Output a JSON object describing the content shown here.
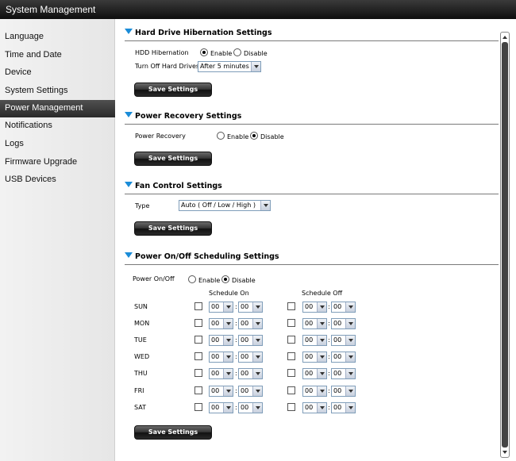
{
  "window": {
    "title": "System Management"
  },
  "sidebar": {
    "items": [
      {
        "label": "Language"
      },
      {
        "label": "Time and Date"
      },
      {
        "label": "Device"
      },
      {
        "label": "System Settings"
      },
      {
        "label": "Power Management",
        "active": true
      },
      {
        "label": "Notifications"
      },
      {
        "label": "Logs"
      },
      {
        "label": "Firmware Upgrade"
      },
      {
        "label": "USB Devices"
      }
    ]
  },
  "hibernation": {
    "title": "Hard Drive Hibernation Settings",
    "hdd_label": "HDD Hibernation",
    "enable_label": "Enable",
    "disable_label": "Disable",
    "selected": "Enable",
    "turnoff_label": "Turn Off Hard Drives",
    "turnoff_value": "After 5 minutes",
    "save_label": "Save Settings"
  },
  "recovery": {
    "title": "Power Recovery Settings",
    "label": "Power Recovery",
    "enable_label": "Enable",
    "disable_label": "Disable",
    "selected": "Disable",
    "save_label": "Save Settings"
  },
  "fan": {
    "title": "Fan Control Settings",
    "type_label": "Type",
    "type_value": "Auto ( Off / Low / High )",
    "save_label": "Save Settings"
  },
  "schedule": {
    "title": "Power On/Off Scheduling Settings",
    "label": "Power On/Off",
    "enable_label": "Enable",
    "disable_label": "Disable",
    "selected": "Disable",
    "on_header": "Schedule On",
    "off_header": "Schedule Off",
    "colon": ":",
    "days": [
      {
        "day": "SUN",
        "on_h": "00",
        "on_m": "00",
        "off_h": "00",
        "off_m": "00"
      },
      {
        "day": "MON",
        "on_h": "00",
        "on_m": "00",
        "off_h": "00",
        "off_m": "00"
      },
      {
        "day": "TUE",
        "on_h": "00",
        "on_m": "00",
        "off_h": "00",
        "off_m": "00"
      },
      {
        "day": "WED",
        "on_h": "00",
        "on_m": "00",
        "off_h": "00",
        "off_m": "00"
      },
      {
        "day": "THU",
        "on_h": "00",
        "on_m": "00",
        "off_h": "00",
        "off_m": "00"
      },
      {
        "day": "FRI",
        "on_h": "00",
        "on_m": "00",
        "off_h": "00",
        "off_m": "00"
      },
      {
        "day": "SAT",
        "on_h": "00",
        "on_m": "00",
        "off_h": "00",
        "off_m": "00"
      }
    ],
    "save_label": "Save Settings"
  },
  "colors": {
    "accent": "#1a8cd8",
    "titlebar": "#1a1a1a",
    "active_item": "#3a3a3a"
  }
}
